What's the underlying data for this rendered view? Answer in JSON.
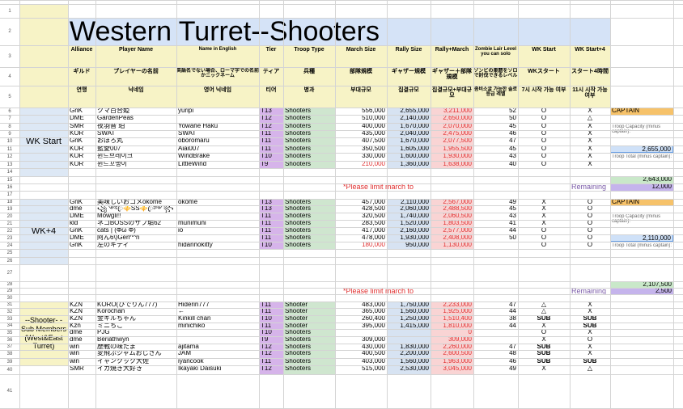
{
  "sheet": {
    "title": "Western Turret--Shooters",
    "row_numbers": [
      "1",
      "2",
      "3",
      "4",
      "5",
      "6",
      "7",
      "8",
      "9",
      "10",
      "11",
      "12",
      "13",
      "14",
      "15",
      "16",
      "17",
      "18",
      "19",
      "20",
      "21",
      "22",
      "23",
      "24",
      "25",
      "26",
      "27",
      "28",
      "29",
      "30",
      "31",
      "32",
      "33",
      "34",
      "35",
      "36",
      "37",
      "38",
      "39",
      "40",
      "41"
    ],
    "header_en": [
      "Alliance",
      "Player Name",
      "Name in English",
      "Tier",
      "Troop Type",
      "March Size",
      "Rally Size",
      "Rally+March",
      "Zombie Lair Level you can solo",
      "WK Start",
      "WK Start+4"
    ],
    "header_jp": [
      "ギルド",
      "プレイヤーの名前",
      "英語名でない場合、ローマ字での名前かニックネーム",
      "ティア",
      "兵種",
      "部隊規模",
      "ギャザー規模",
      "ギャザー＋部隊規模",
      "ゾンビの巣窟をソロで討伐できるレベル",
      "WKスタート",
      "スタート4時間"
    ],
    "header_kr": [
      "연맹",
      "닉네임",
      "영어 닉네임",
      "티어",
      "병과",
      "부대규모",
      "집결규모",
      "집결규모+부대규모",
      "좀비소굴 가능한 솔로등급 레벨",
      "7시 시작 가능 여부",
      "11시 시작 가능 여부"
    ],
    "group_labels": {
      "wk_start": "WK Start",
      "wk_plus4": "WK+4",
      "sub": "--Shooter- - Sub Members (West&East Turret)"
    },
    "notes": {
      "limit1": "*Please limit march to",
      "limit2": "*Please limit march to",
      "remaining1": "Remaining",
      "remaining2": "Remaining"
    },
    "side_panel": {
      "captain1": "CAPTAIN",
      "captain2": "CAPTAIN",
      "troop_capacity_label": "Troop Capacity (minus captain):",
      "troop_total_label": "Troop Total (minus captain):",
      "cap1": "2,655,000",
      "total1": "2,643,000",
      "remaining1": "12,000",
      "cap2": "2,110,000",
      "total2": "2,107,500",
      "remaining2": "2,500"
    },
    "wk_start_rows": [
      [
        "GnK",
        "クマ百合姫",
        "yuripi",
        "T13",
        "Shooters",
        "556,000",
        "2,655,000",
        "3,211,000",
        "52",
        "O",
        "X"
      ],
      [
        "DME",
        "GardenPeas",
        "",
        "T12",
        "Shooters",
        "510,000",
        "2,140,000",
        "2,650,000",
        "50",
        "O",
        "△"
      ],
      [
        "SMR",
        "夜羽音 珀",
        "Yowane Haku",
        "T12",
        "Shooters",
        "400,000",
        "1,670,000",
        "2,070,000",
        "45",
        "O",
        "X"
      ],
      [
        "KOR",
        "SWAT",
        "SWAT",
        "T11",
        "Shooters",
        "435,000",
        "2,040,000",
        "2,475,000",
        "46",
        "O",
        "X"
      ],
      [
        "GnK",
        "おぼろ丸",
        "oboromaru",
        "T11",
        "Shooters",
        "407,500",
        "1,670,000",
        "2,077,500",
        "47",
        "O",
        "X"
      ],
      [
        "KOR",
        "藍愛007",
        "Aiai007",
        "T11",
        "Shooters",
        "350,500",
        "1,605,000",
        "1,955,500",
        "45",
        "O",
        "X"
      ],
      [
        "KOR",
        "윈드브레이크",
        "WindBrake",
        "T10",
        "Shooters",
        "330,000",
        "1,600,000",
        "1,930,000",
        "43",
        "O",
        "X"
      ],
      [
        "KOR",
        "윈드꼬맹이",
        "LittleWind",
        "T9",
        "Shooters",
        "210,000",
        "1,360,000",
        "1,638,000",
        "40",
        "O",
        "X"
      ]
    ],
    "wk_plus4_rows": [
      [
        "GnK",
        "美味しいおコメokome",
        "okome",
        "T13",
        "Shooters",
        "457,000",
        "2,110,000",
        "2,567,000",
        "49",
        "X",
        "O"
      ],
      [
        "dme",
        "꧁༺ꦿ⚜️SS⚜️ꦿ༻꧂",
        "",
        "T13",
        "Shooters",
        "428,500",
        "2,060,000",
        "2,488,500",
        "45",
        "X",
        "O"
      ],
      [
        "DME",
        "Mowgli!!",
        "",
        "T11",
        "Shooters",
        "320,500",
        "1,740,000",
        "2,060,500",
        "43",
        "X",
        "O"
      ],
      [
        "kld",
        "ネコBOSSのサブ垢62",
        "munimuni",
        "T11",
        "Shooters",
        "283,500",
        "1,520,000",
        "1,803,500",
        "41",
        "X",
        "O"
      ],
      [
        "GnK",
        "cats | (Φω Φ)",
        "io",
        "T11",
        "Shooters",
        "417,000",
        "2,160,000",
        "2,577,000",
        "44",
        "O",
        "O"
      ],
      [
        "DME",
        "阿ん6\\)Gerl^^n",
        "",
        "T11",
        "Shooters",
        "478,000",
        "1,930,000",
        "2,408,000",
        "50",
        "O",
        "O"
      ],
      [
        "GnK",
        "左のキティ",
        "hidarinokitty",
        "T10",
        "Shooters",
        "180,000",
        "950,000",
        "1,130,000",
        "",
        "O",
        "O"
      ]
    ],
    "sub_rows": [
      [
        "KZN",
        "KORO(ひでりん777)",
        "Hiderin777",
        "T11",
        "Shooter",
        "483,000",
        "1,750,000",
        "2,233,000",
        "47",
        "△",
        "X"
      ],
      [
        "KZN",
        "Korochan",
        "←",
        "T11",
        "Shooter",
        "365,000",
        "1,560,000",
        "1,925,000",
        "44",
        "△",
        "X"
      ],
      [
        "KZN",
        "金キルちゃん",
        "Kinkill chan",
        "T10",
        "Shooter",
        "260,400",
        "1,250,000",
        "1,510,400",
        "38",
        "SUB",
        "SUB"
      ],
      [
        "Kzn",
        "ミニちこ",
        "minichiko",
        "T11",
        "Shooter",
        "395,000",
        "1,415,000",
        "1,810,000",
        "44",
        "X",
        "SUB"
      ],
      [
        "dme",
        "PJG",
        "",
        "T10",
        "Shooters",
        "",
        "",
        "0",
        "",
        "O",
        "X"
      ],
      [
        "dme",
        "Beriathwyn",
        "",
        "T9",
        "Shooters",
        "309,000",
        "",
        "309,000",
        "",
        "X",
        "O"
      ],
      [
        "win",
        "歴戦の味たま",
        "ajitama",
        "T12",
        "Shooters",
        "430,000",
        "1,830,000",
        "2,260,000",
        "47",
        "SUB",
        "X"
      ],
      [
        "win",
        "変飛ぶジャムおじさん",
        "JAM",
        "T12",
        "Shooters",
        "400,500",
        "2,200,000",
        "2,600,500",
        "48",
        "SUB",
        "X"
      ],
      [
        "win",
        "イャンクック大佐",
        "iyancook",
        "T11",
        "Shooters",
        "403,000",
        "1,560,000",
        "1,963,000",
        "46",
        "SUB",
        "SUB"
      ],
      [
        "SMR",
        "イカ焼き大好き",
        "Ikayaki Daisuki",
        "T12",
        "Shooters",
        "515,000",
        "2,530,000",
        "3,045,000",
        "49",
        "X",
        "△"
      ]
    ],
    "colors": {
      "group_bg": "#dde8f5",
      "header_bg": "#f7f3c6",
      "title_bg": "#d5e3f7",
      "tier_bg": "#d6b4ea",
      "troop_bg": "#cfe6cf",
      "rally_bg": "#d7e3f2",
      "rallymarch_bg": "#f9d4d4",
      "red_text": "#e03030",
      "side_captain_bg": "#f6c26a",
      "side_total_bg": "#c9e8c9",
      "side_remaining_bg": "#c5b4ec",
      "side_cap_bg": "#cfe1f8"
    }
  }
}
